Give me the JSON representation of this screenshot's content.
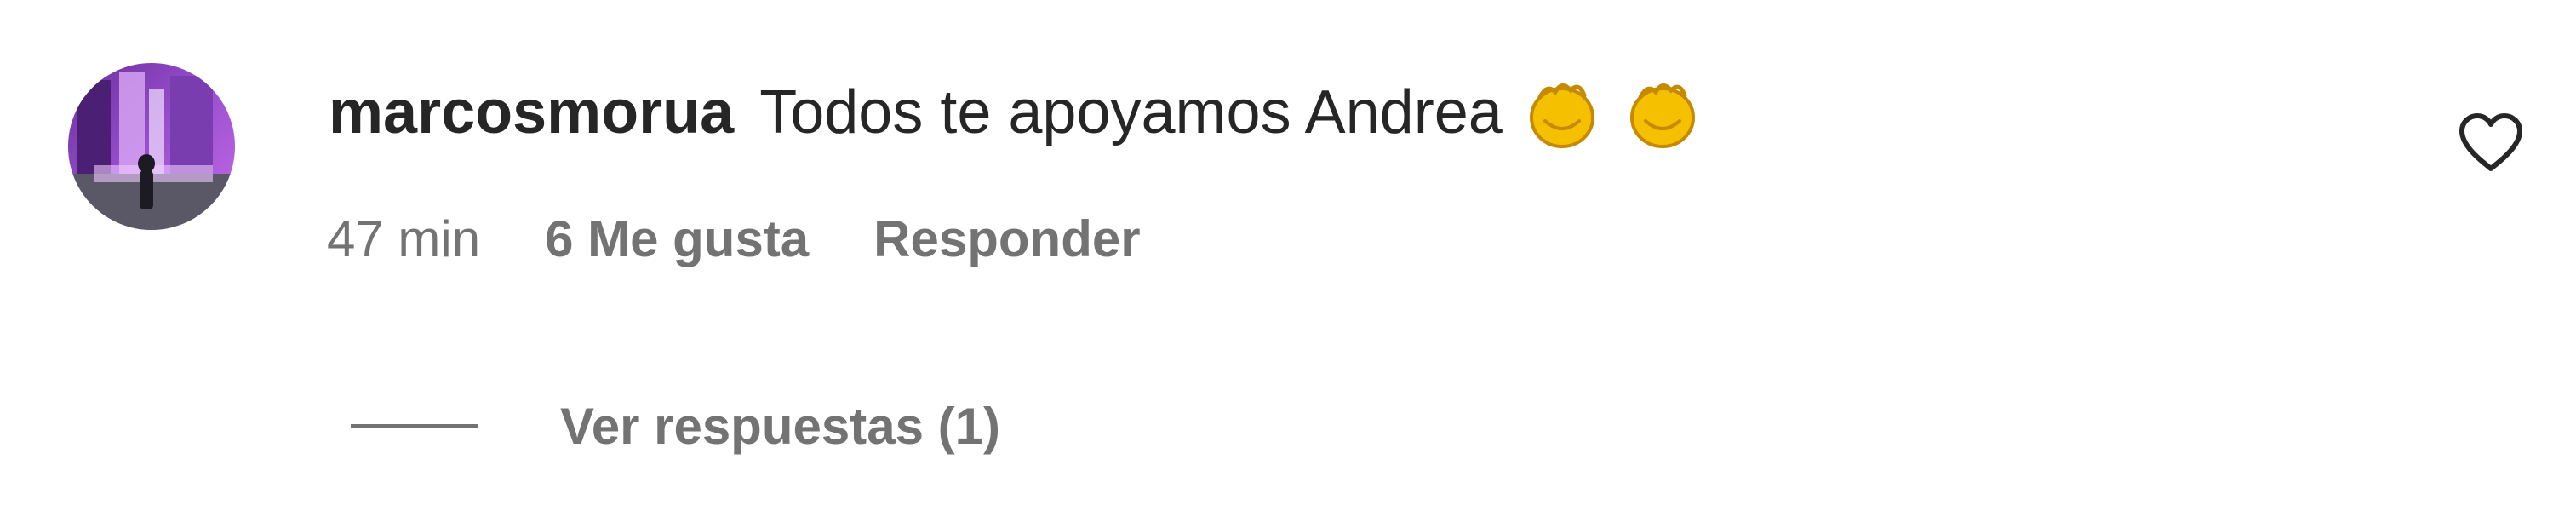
{
  "comment": {
    "username": "marcosmorua",
    "text": "Todos te apoyamos Andrea",
    "emojis": [
      "clapping-hands",
      "clapping-hands"
    ],
    "time": "47 min",
    "likes": "6 Me gusta",
    "reply_label": "Responder",
    "view_replies_label": "Ver respuestas (1)"
  },
  "icons": {
    "like": "heart-outline-icon",
    "avatar": "user-avatar"
  },
  "colors": {
    "primary_text": "#262626",
    "secondary_text": "#737373",
    "background": "#ffffff",
    "emoji": "#f5c000"
  }
}
